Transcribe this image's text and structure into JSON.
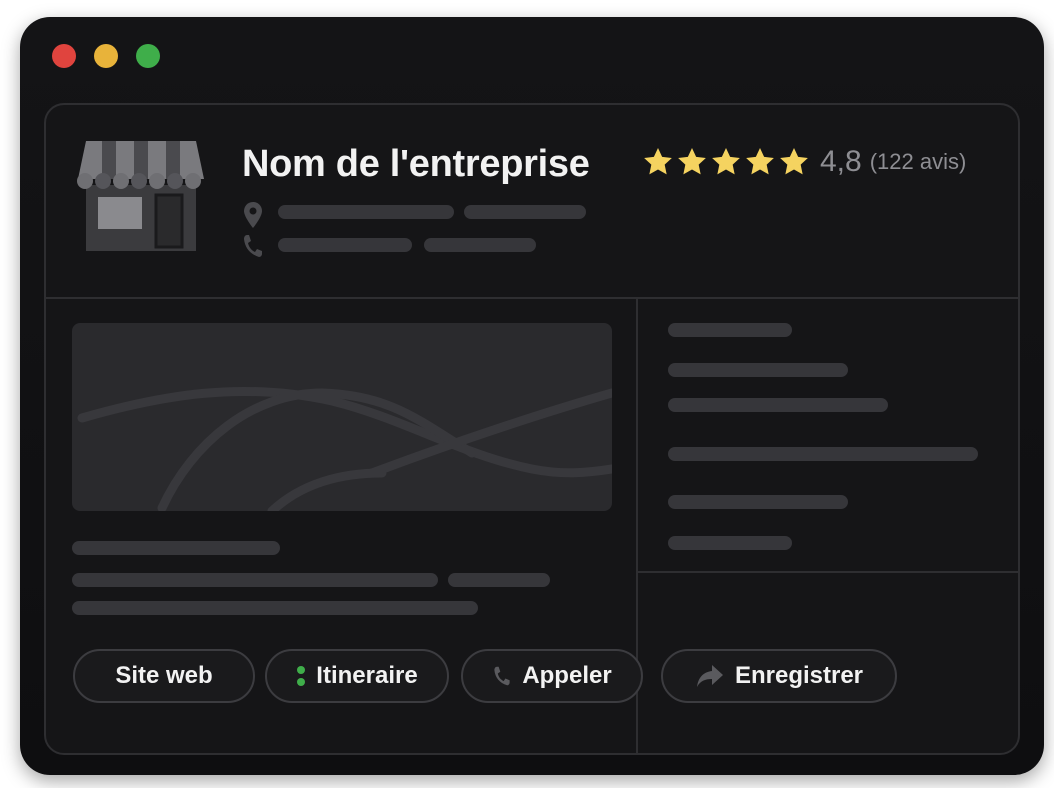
{
  "window": {
    "controls": [
      "close",
      "minimize",
      "maximize"
    ]
  },
  "business": {
    "name": "Nom de l'entreprise",
    "rating": {
      "stars": 5,
      "value": "4,8",
      "count_text": "(122 avis)"
    },
    "icons": {
      "store": "storefront-icon",
      "location": "pin-icon",
      "phone": "phone-icon"
    }
  },
  "actions": {
    "website": "Site web",
    "directions": "Itineraire",
    "call": "Appeler",
    "save": "Enregistrer"
  },
  "colors": {
    "star": "#f5d360",
    "background": "#141416",
    "text": "#f2f2f2",
    "muted": "#8e8e93",
    "route_accent": "#3fae4a"
  }
}
